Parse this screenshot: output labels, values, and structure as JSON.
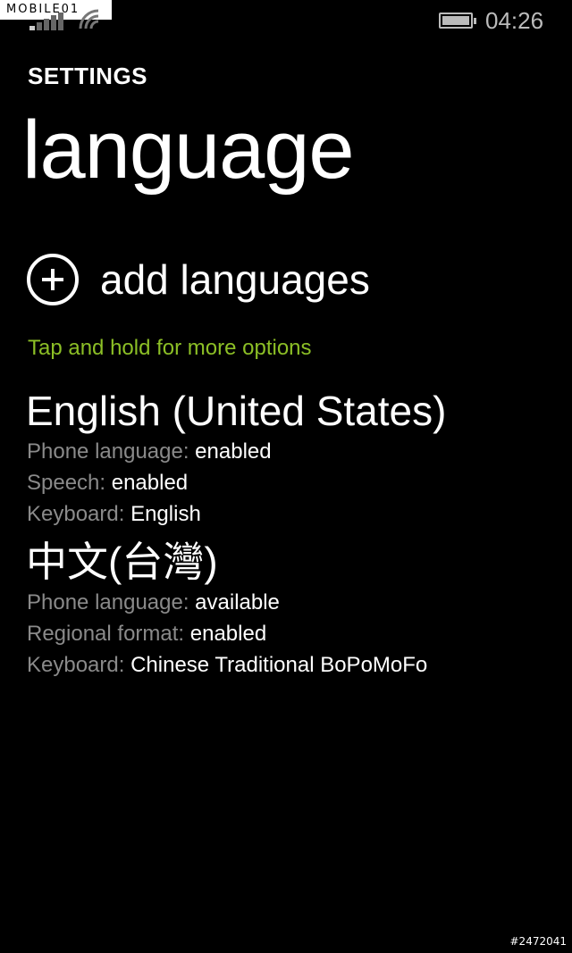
{
  "watermark": "MOBILE01",
  "status_bar": {
    "time": "04:26"
  },
  "header": {
    "section": "SETTINGS",
    "title": "language"
  },
  "add_languages": {
    "label": "add languages"
  },
  "hint": "Tap and hold for more options",
  "languages": [
    {
      "name": "English (United States)",
      "details": [
        {
          "key": "Phone language: ",
          "value": "enabled"
        },
        {
          "key": "Speech: ",
          "value": "enabled"
        },
        {
          "key": "Keyboard: ",
          "value": "English"
        }
      ]
    },
    {
      "name": "中文(台灣)",
      "details": [
        {
          "key": "Phone language: ",
          "value": "available"
        },
        {
          "key": "Regional format: ",
          "value": "enabled"
        },
        {
          "key": "Keyboard: ",
          "value": "Chinese Traditional BoPoMoFo"
        }
      ]
    }
  ],
  "footer_id": "#2472041",
  "colors": {
    "accent": "#8cbf26",
    "secondary_text": "#8a8a8a",
    "background": "#000000"
  }
}
